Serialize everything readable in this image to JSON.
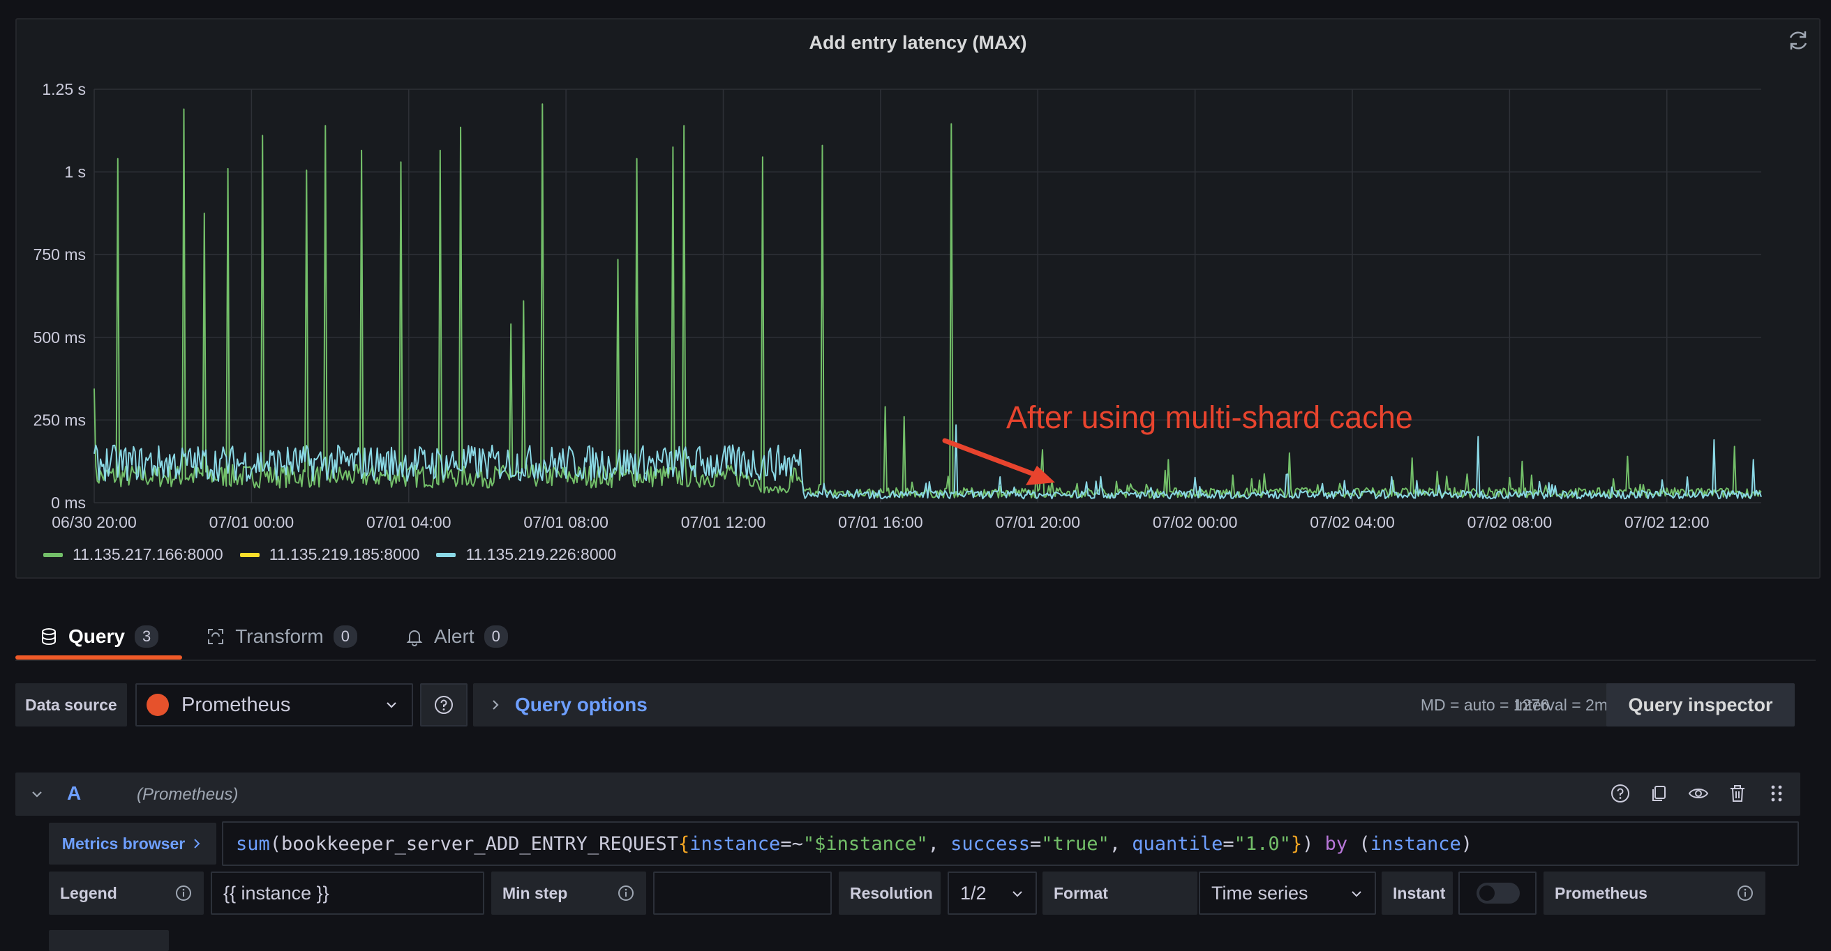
{
  "panel": {
    "title": "Add entry latency (MAX)",
    "annotation": "After using multi-shard cache"
  },
  "chart_data": {
    "type": "line",
    "title": "Add entry latency (MAX)",
    "y_ticks": [
      "0 ms",
      "250 ms",
      "500 ms",
      "750 ms",
      "1 s",
      "1.25 s"
    ],
    "y_tick_values": [
      0,
      250,
      500,
      750,
      1000,
      1250
    ],
    "ylim": [
      0,
      1250
    ],
    "x_ticks": [
      "06/30 20:00",
      "07/01 00:00",
      "07/01 04:00",
      "07/01 08:00",
      "07/01 12:00",
      "07/01 16:00",
      "07/01 20:00",
      "07/02 00:00",
      "07/02 04:00",
      "07/02 08:00",
      "07/02 12:00"
    ],
    "x_tick_hours": [
      0,
      4,
      8,
      12,
      16,
      20,
      24,
      28,
      32,
      36,
      40
    ],
    "xlim_hours": [
      0,
      42.4
    ],
    "grid": true,
    "legend_position": "bottom-left",
    "series": [
      {
        "name": "11.135.217.166:8000",
        "color": "#73bf69",
        "spikes": [
          {
            "t": 0.0,
            "v": 345
          },
          {
            "t": 0.6,
            "v": 1040
          },
          {
            "t": 2.3,
            "v": 1190
          },
          {
            "t": 2.8,
            "v": 875
          },
          {
            "t": 3.4,
            "v": 1010
          },
          {
            "t": 4.3,
            "v": 1110
          },
          {
            "t": 5.4,
            "v": 1005
          },
          {
            "t": 5.9,
            "v": 1140
          },
          {
            "t": 6.8,
            "v": 1065
          },
          {
            "t": 7.8,
            "v": 1030
          },
          {
            "t": 8.8,
            "v": 1065
          },
          {
            "t": 9.3,
            "v": 1135
          },
          {
            "t": 10.6,
            "v": 540
          },
          {
            "t": 10.9,
            "v": 610
          },
          {
            "t": 11.4,
            "v": 1205
          },
          {
            "t": 13.3,
            "v": 735
          },
          {
            "t": 13.8,
            "v": 1040
          },
          {
            "t": 14.7,
            "v": 1075
          },
          {
            "t": 15.0,
            "v": 1140
          },
          {
            "t": 17.0,
            "v": 1045
          },
          {
            "t": 18.5,
            "v": 1080
          },
          {
            "t": 20.1,
            "v": 290
          },
          {
            "t": 20.6,
            "v": 260
          },
          {
            "t": 21.8,
            "v": 1145
          },
          {
            "t": 24.1,
            "v": 160
          },
          {
            "t": 27.3,
            "v": 130
          },
          {
            "t": 30.4,
            "v": 150
          },
          {
            "t": 33.5,
            "v": 135
          },
          {
            "t": 36.3,
            "v": 125
          },
          {
            "t": 39.0,
            "v": 140
          },
          {
            "t": 41.7,
            "v": 170
          }
        ],
        "baseline_before_ms": 80,
        "baseline_after_ms": 15
      },
      {
        "name": "11.135.219.185:8000",
        "color": "#fade2a",
        "spikes": [],
        "baseline_before_ms": 0,
        "baseline_after_ms": 0
      },
      {
        "name": "11.135.219.226:8000",
        "color": "#8ad8e5",
        "spikes": [
          {
            "t": 21.9,
            "v": 235
          },
          {
            "t": 35.2,
            "v": 200
          },
          {
            "t": 41.2,
            "v": 190
          },
          {
            "t": 42.2,
            "v": 130
          }
        ],
        "baseline_before_ms": 120,
        "baseline_after_ms": 12
      }
    ]
  },
  "tabs": [
    {
      "label": "Query",
      "count": "3",
      "icon": "database-icon"
    },
    {
      "label": "Transform",
      "count": "0",
      "icon": "transform-icon"
    },
    {
      "label": "Alert",
      "count": "0",
      "icon": "bell-icon"
    }
  ],
  "datasource": {
    "label": "Data source",
    "value": "Prometheus",
    "query_options": "Query options",
    "md": "MD = auto = 1276",
    "interval": "Interval = 2m",
    "inspector": "Query inspector"
  },
  "query": {
    "letter": "A",
    "datasource": "(Prometheus)",
    "metrics_browser": "Metrics browser",
    "expr_parts": [
      {
        "cls": "t-fn",
        "text": "sum"
      },
      {
        "cls": "t-paren",
        "text": "("
      },
      {
        "cls": "t-metric",
        "text": "bookkeeper_server_ADD_ENTRY_REQUEST"
      },
      {
        "cls": "t-br",
        "text": "{"
      },
      {
        "cls": "t-lbl",
        "text": "instance"
      },
      {
        "cls": "t-op",
        "text": "=~"
      },
      {
        "cls": "t-str",
        "text": "\"$instance\""
      },
      {
        "cls": "t-op",
        "text": ", "
      },
      {
        "cls": "t-lbl",
        "text": "success"
      },
      {
        "cls": "t-op",
        "text": "="
      },
      {
        "cls": "t-str",
        "text": "\"true\""
      },
      {
        "cls": "t-op",
        "text": ", "
      },
      {
        "cls": "t-lbl",
        "text": "quantile"
      },
      {
        "cls": "t-op",
        "text": "="
      },
      {
        "cls": "t-str",
        "text": "\"1.0\""
      },
      {
        "cls": "t-br",
        "text": "}"
      },
      {
        "cls": "t-paren",
        "text": ") "
      },
      {
        "cls": "t-kw",
        "text": "by"
      },
      {
        "cls": "t-paren",
        "text": " ("
      },
      {
        "cls": "t-lbl",
        "text": "instance"
      },
      {
        "cls": "t-paren",
        "text": ")"
      }
    ],
    "legend_label": "Legend",
    "legend_value": "{{ instance }}",
    "min_step_label": "Min step",
    "min_step_value": "",
    "resolution_label": "Resolution",
    "resolution_value": "1/2",
    "format_label": "Format",
    "format_value": "Time series",
    "instant_label": "Instant",
    "type_label": "Prometheus"
  }
}
